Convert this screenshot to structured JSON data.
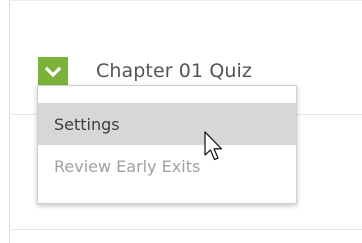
{
  "quiz": {
    "title": "Chapter 01 Quiz",
    "toggle_icon": "chevron-down-icon",
    "accent_color": "#7bb33a"
  },
  "menu": {
    "items": [
      {
        "label": "Settings",
        "state": "hover"
      },
      {
        "label": "Review Early Exits",
        "state": "disabled"
      }
    ]
  },
  "cursor": {
    "icon": "arrow-pointer-icon"
  }
}
